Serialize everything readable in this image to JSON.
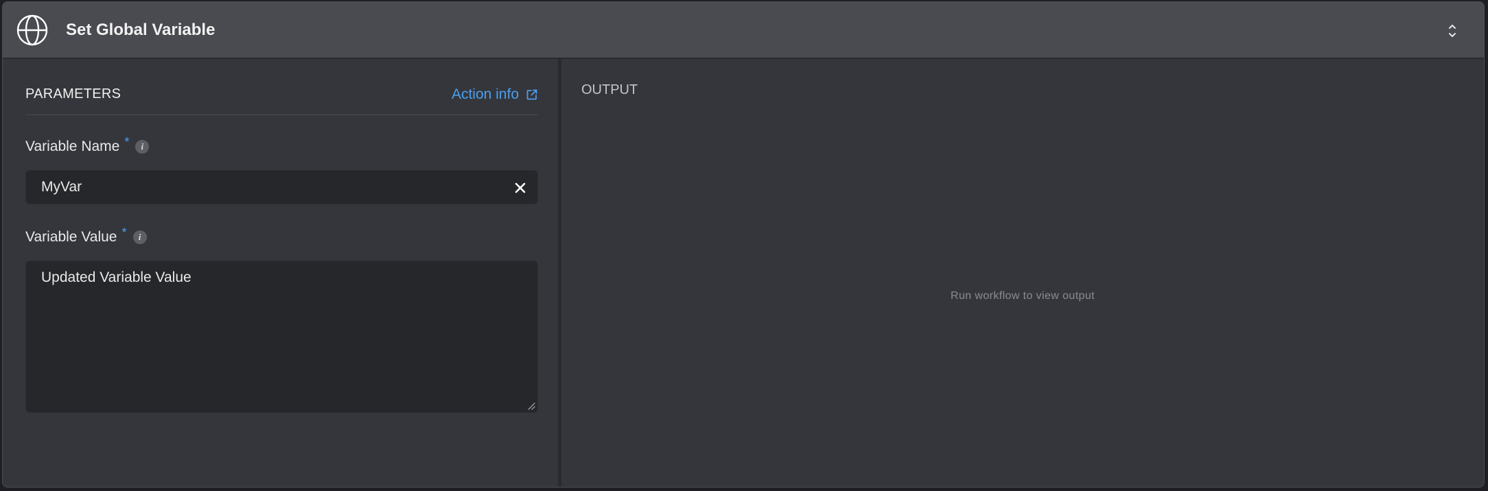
{
  "header": {
    "title": "Set Global Variable",
    "icon": "globe-icon",
    "toggle_icon": "chevron-up-down-icon"
  },
  "parameters": {
    "section_title": "PARAMETERS",
    "action_info_label": "Action info",
    "action_info_icon": "external-link-icon",
    "fields": [
      {
        "label": "Variable Name",
        "required_mark": "*",
        "info_icon": "i",
        "value": "MyVar"
      },
      {
        "label": "Variable Value",
        "required_mark": "*",
        "info_icon": "i",
        "value": "Updated Variable Value"
      }
    ]
  },
  "output": {
    "section_title": "OUTPUT",
    "empty_message": "Run workflow to view output"
  },
  "colors": {
    "accent": "#4a9ff0",
    "header_bg": "#4a4b51",
    "panel_bg": "#35363b",
    "input_bg": "#26272b"
  }
}
